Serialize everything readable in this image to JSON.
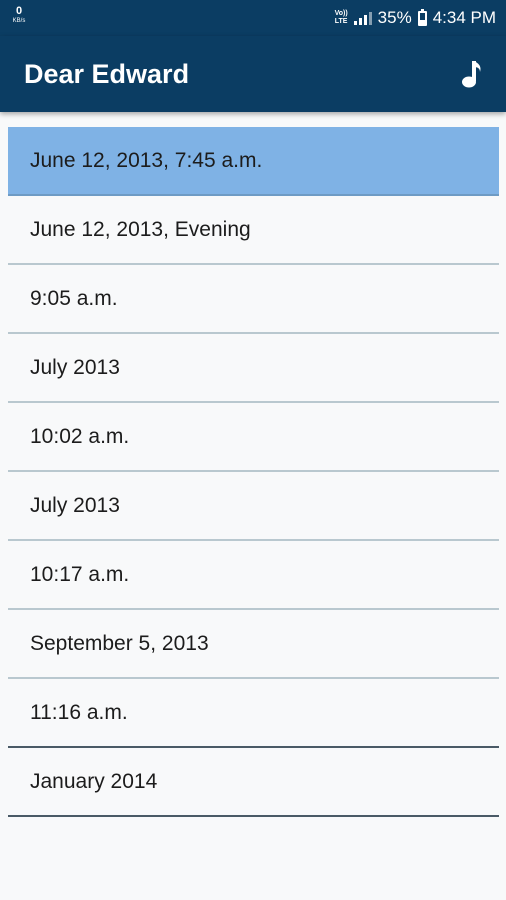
{
  "status_bar": {
    "data_speed": "0",
    "data_unit": "KB/s",
    "volte_top": "Vo))",
    "volte_bottom": "LTE",
    "battery": "35%",
    "time": "4:34 PM"
  },
  "app_bar": {
    "title": "Dear Edward",
    "action_icon": "music-note-icon"
  },
  "entries": [
    {
      "label": "June 12, 2013, 7:45 a.m.",
      "selected": true
    },
    {
      "label": "June 12, 2013, Evening",
      "selected": false
    },
    {
      "label": "9:05 a.m.",
      "selected": false
    },
    {
      "label": "July 2013",
      "selected": false
    },
    {
      "label": "10:02 a.m.",
      "selected": false
    },
    {
      "label": "July  2013",
      "selected": false
    },
    {
      "label": "10:17 a.m.",
      "selected": false
    },
    {
      "label": "September 5, 2013",
      "selected": false
    },
    {
      "label": "11:16 a.m.",
      "selected": false
    },
    {
      "label": "January 2014",
      "selected": false
    }
  ],
  "colors": {
    "app_bar": "#0b3d63",
    "selected_row": "#7fb2e5",
    "background": "#f8f9fa"
  }
}
